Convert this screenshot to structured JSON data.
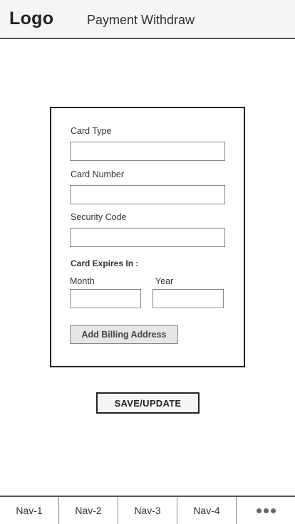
{
  "header": {
    "logo": "Logo",
    "title": "Payment Withdraw"
  },
  "form": {
    "card_type_label": "Card Type",
    "card_type_value": "",
    "card_number_label": "Card Number",
    "card_number_value": "",
    "security_code_label": "Security Code",
    "security_code_value": "",
    "expires_label": "Card Expires In :",
    "month_label": "Month",
    "month_value": "",
    "year_label": "Year",
    "year_value": "",
    "billing_button_label": "Add Billing Address"
  },
  "actions": {
    "save_label": "SAVE/UPDATE"
  },
  "bottom_nav": {
    "items": [
      "Nav-1",
      "Nav-2",
      "Nav-3",
      "Nav-4"
    ],
    "more_icon": "more-dots-icon"
  }
}
